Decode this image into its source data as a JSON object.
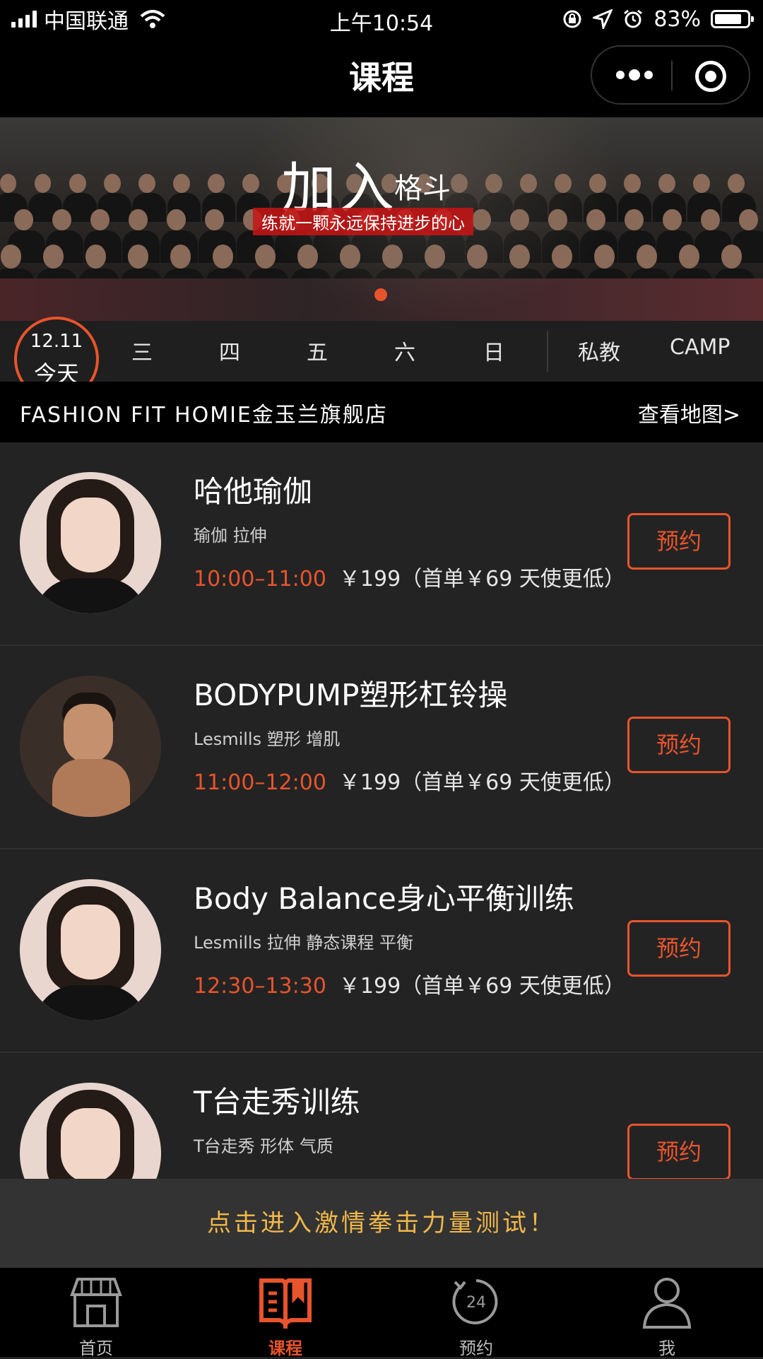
{
  "status_bar": {
    "carrier": "中国联通",
    "time": "上午10:54",
    "battery": "83%",
    "battery_level": 0.83
  },
  "nav": {
    "title": "课程"
  },
  "banner": {
    "headline": "加入",
    "headline_sub": "格斗",
    "tagline": "练就一颗永远保持进步的心"
  },
  "day_tabs": {
    "today_date": "12.11",
    "today_label": "今天",
    "days": [
      "三",
      "四",
      "五",
      "六",
      "日"
    ],
    "extra": [
      "私教",
      "CAMP"
    ]
  },
  "store": {
    "name": "FASHION FIT HOMIE金玉兰旗舰店",
    "map_link": "查看地图>"
  },
  "courses": [
    {
      "title": "哈他瑜伽",
      "tags": "瑜伽 拉伸",
      "time": "10:00–11:00",
      "price": "￥199（首单￥69 天使更低）",
      "book": "预约"
    },
    {
      "title": "BODYPUMP塑形杠铃操",
      "tags": "Lesmills 塑形 增肌",
      "time": "11:00–12:00",
      "price": "￥199（首单￥69 天使更低）",
      "book": "预约"
    },
    {
      "title": "Body Balance身心平衡训练",
      "tags": "Lesmills 拉伸 静态课程 平衡",
      "time": "12:30–13:30",
      "price": "￥199（首单￥69 天使更低）",
      "book": "预约"
    },
    {
      "title": "T台走秀训练",
      "tags": "T台走秀 形体 气质",
      "time": "",
      "price": "",
      "book": "预约"
    }
  ],
  "promo": {
    "text": "点击进入激情拳击力量测试！"
  },
  "tabbar": {
    "items": [
      {
        "label": "首页",
        "icon": "storefront-icon"
      },
      {
        "label": "课程",
        "icon": "book-icon"
      },
      {
        "label": "预约",
        "icon": "clock-24-icon",
        "icon_text": "24"
      },
      {
        "label": "我",
        "icon": "user-icon"
      }
    ],
    "active_index": 1,
    "active_color": "#e8542c"
  },
  "colors": {
    "accent": "#e8542c",
    "promo_text": "#f2b84a",
    "background": "#232323"
  }
}
